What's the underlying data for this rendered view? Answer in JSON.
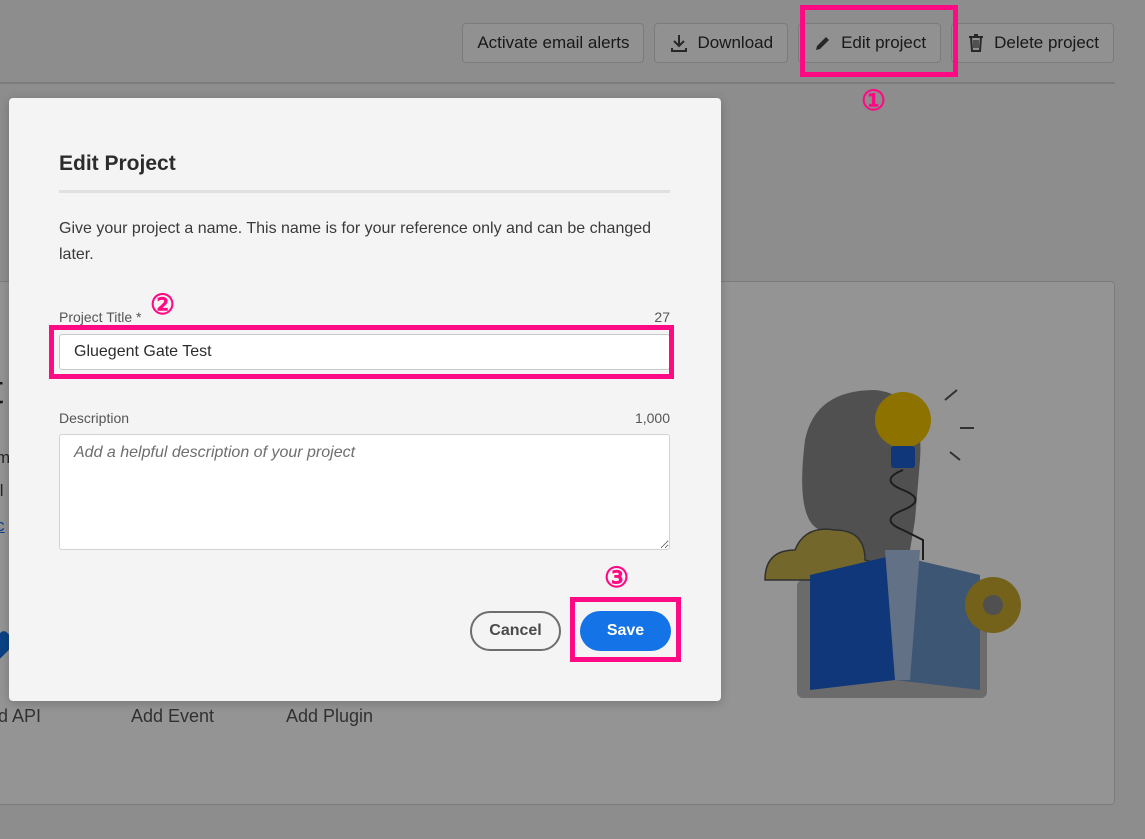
{
  "toolbar": {
    "activate_label": "Activate email alerts",
    "download_label": "Download",
    "edit_label": "Edit project",
    "delete_label": "Delete project"
  },
  "background": {
    "title_fragment": "t",
    "line_fragments": [
      "m",
      "ll"
    ],
    "link_fragment": "c",
    "add_api": "ld API",
    "add_event": "Add Event",
    "add_plugin": "Add Plugin"
  },
  "dialog": {
    "title": "Edit Project",
    "description": "Give your project a name. This name is for your reference only and can be changed later.",
    "project_title_label": "Project Title *",
    "project_title_count": "27",
    "project_title_value": "Gluegent Gate Test",
    "description_label": "Description",
    "description_count": "1,000",
    "description_placeholder": "Add a helpful description of your project",
    "cancel_label": "Cancel",
    "save_label": "Save"
  },
  "annotations": {
    "step1": "①",
    "step2": "②",
    "step3": "③"
  },
  "colors": {
    "accent": "#1473e6",
    "highlight": "#ff0a84"
  }
}
